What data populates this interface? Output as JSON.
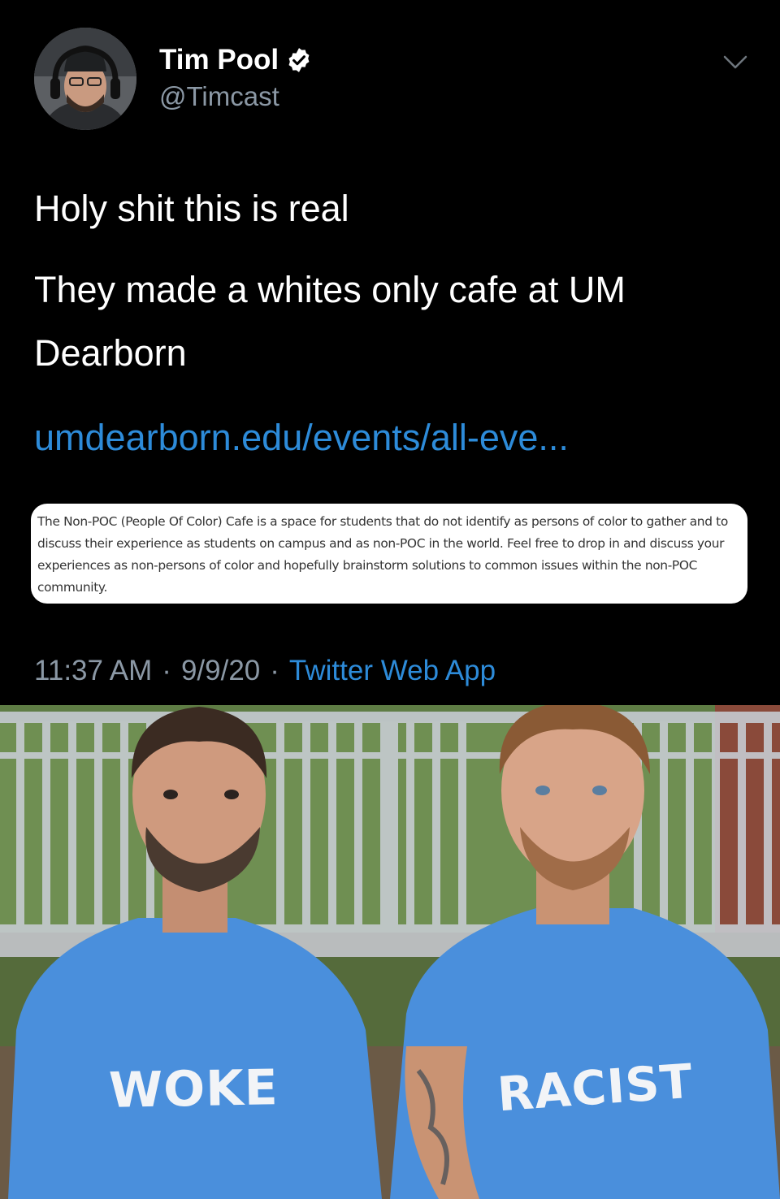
{
  "tweet": {
    "author_name": "Tim Pool",
    "handle": "@Timcast",
    "text_line1": "Holy shit this is real",
    "text_line2": "They made a whites only cafe at UM Dearborn",
    "link": "umdearborn.edu/events/all-eve...",
    "screenshot_text": "The Non-POC (People Of Color) Cafe is a space for students that do not identify as persons of color to gather and to discuss their experience as students on campus and as non-POC in the world. Feel free to drop in and discuss your experiences as non-persons of color and hopefully brainstorm solutions to common issues within the non-POC community.",
    "time": "11:37 AM",
    "date": "9/9/20",
    "source": "Twitter Web App",
    "separator": "·",
    "icons": [
      "avatar",
      "verified-badge-icon",
      "chevron-down-icon"
    ],
    "colors": {
      "background": "#000000",
      "link": "#2d8bd9",
      "secondary_text": "#8b98a5"
    }
  },
  "meme_photo": {
    "left_shirt": "WOKE",
    "right_shirt": "RACIST",
    "shirt_color": "#4a8fdc"
  }
}
